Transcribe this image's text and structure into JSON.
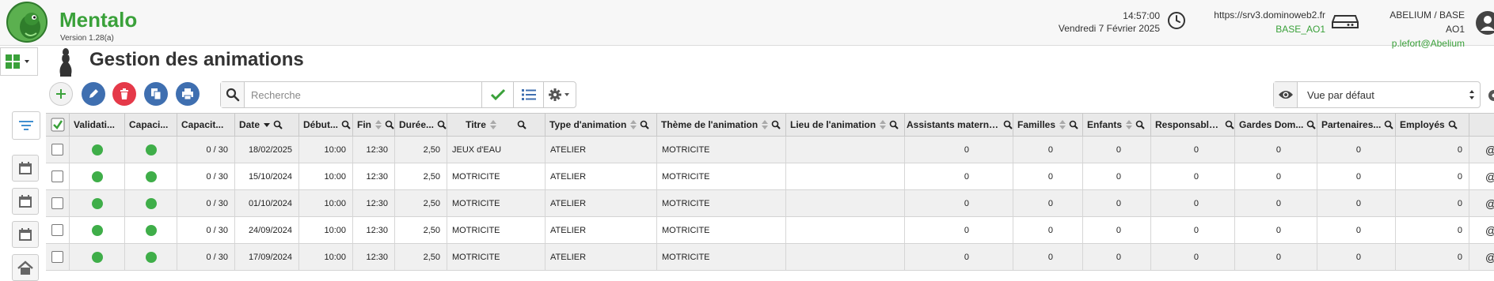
{
  "header": {
    "app_name": "Mentalo",
    "version": "Version 1.28(a)",
    "time": "14:57:00",
    "date": "Vendredi 7 Février 2025",
    "server_url": "https://srv3.dominoweb2.fr",
    "base": "BASE_AO1",
    "org": "ABELIUM / BASE AO1",
    "user": "p.lefort@Abelium"
  },
  "page": {
    "title": "Gestion des animations"
  },
  "search": {
    "placeholder": "Recherche",
    "value": ""
  },
  "view": {
    "selected": "Vue par défaut"
  },
  "colors": {
    "brand": "#3aa13a",
    "status_green": "#3fae49",
    "button_blue": "#3f6fb0",
    "button_red": "#e53949"
  },
  "table": {
    "columns": [
      "Validati...",
      "Capaci...",
      "Capacit...",
      "Date",
      "Début...",
      "Fin",
      "Durée...",
      "Titre",
      "Type d'animation",
      "Thème de l'animation",
      "Lieu de l'animation",
      "Assistants materne...",
      "Familles",
      "Enfants",
      "Responsable...",
      "Gardes Dom...",
      "Partenaires...",
      "Employés"
    ],
    "rows": [
      {
        "capacite": "0 / 30",
        "date": "18/02/2025",
        "debut": "10:00",
        "fin": "12:30",
        "duree": "2,50",
        "titre": "JEUX d'EAU",
        "type": "ATELIER",
        "theme": "MOTRICITE",
        "lieu": "",
        "assistants": "0",
        "familles": "0",
        "enfants": "0",
        "responsables": "0",
        "gardes": "0",
        "partenaires": "0",
        "employes": "0",
        "extra": "@"
      },
      {
        "capacite": "0 / 30",
        "date": "15/10/2024",
        "debut": "10:00",
        "fin": "12:30",
        "duree": "2,50",
        "titre": "MOTRICITE",
        "type": "ATELIER",
        "theme": "MOTRICITE",
        "lieu": "",
        "assistants": "0",
        "familles": "0",
        "enfants": "0",
        "responsables": "0",
        "gardes": "0",
        "partenaires": "0",
        "employes": "0",
        "extra": "@"
      },
      {
        "capacite": "0 / 30",
        "date": "01/10/2024",
        "debut": "10:00",
        "fin": "12:30",
        "duree": "2,50",
        "titre": "MOTRICITE",
        "type": "ATELIER",
        "theme": "MOTRICITE",
        "lieu": "",
        "assistants": "0",
        "familles": "0",
        "enfants": "0",
        "responsables": "0",
        "gardes": "0",
        "partenaires": "0",
        "employes": "0",
        "extra": "@"
      },
      {
        "capacite": "0 / 30",
        "date": "24/09/2024",
        "debut": "10:00",
        "fin": "12:30",
        "duree": "2,50",
        "titre": "MOTRICITE",
        "type": "ATELIER",
        "theme": "MOTRICITE",
        "lieu": "",
        "assistants": "0",
        "familles": "0",
        "enfants": "0",
        "responsables": "0",
        "gardes": "0",
        "partenaires": "0",
        "employes": "0",
        "extra": "@"
      },
      {
        "capacite": "0 / 30",
        "date": "17/09/2024",
        "debut": "10:00",
        "fin": "12:30",
        "duree": "2,50",
        "titre": "MOTRICITE",
        "type": "ATELIER",
        "theme": "MOTRICITE",
        "lieu": "",
        "assistants": "0",
        "familles": "0",
        "enfants": "0",
        "responsables": "0",
        "gardes": "0",
        "partenaires": "0",
        "employes": "0",
        "extra": "@"
      }
    ]
  }
}
